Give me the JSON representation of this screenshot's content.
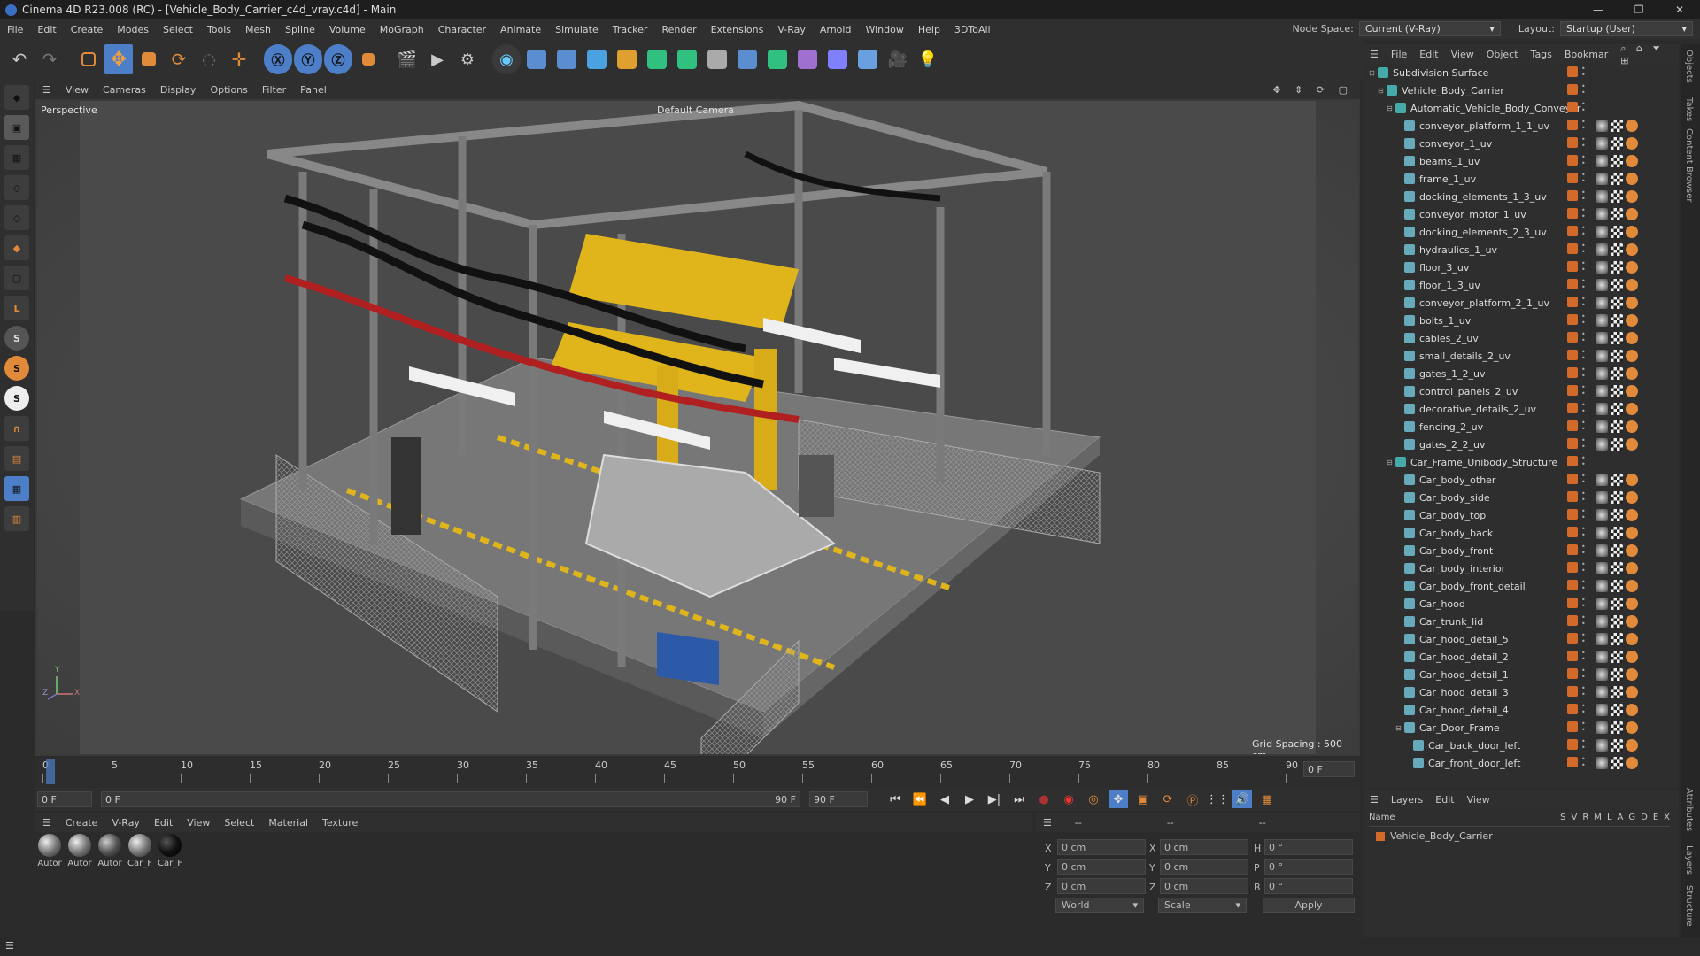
{
  "window": {
    "title": "Cinema 4D R23.008 (RC) - [Vehicle_Body_Carrier_c4d_vray.c4d] - Main",
    "controls": [
      "—",
      "❐",
      "✕"
    ]
  },
  "menu": [
    "File",
    "Edit",
    "Create",
    "Modes",
    "Select",
    "Tools",
    "Mesh",
    "Spline",
    "Volume",
    "MoGraph",
    "Character",
    "Animate",
    "Simulate",
    "Tracker",
    "Render",
    "Extensions",
    "V-Ray",
    "Arnold",
    "Window",
    "Help",
    "3DToAll"
  ],
  "node_space": {
    "label": "Node Space:",
    "value": "Current (V-Ray)"
  },
  "layout": {
    "label": "Layout:",
    "value": "Startup (User)"
  },
  "viewport": {
    "menu": [
      "View",
      "Cameras",
      "Display",
      "Options",
      "Filter",
      "Panel"
    ],
    "view_name": "Perspective",
    "camera": "Default Camera",
    "grid_spacing": "Grid Spacing : 500 cm",
    "axis_labels": [
      "Y",
      "X",
      "Z"
    ]
  },
  "timeline": {
    "ticks": [
      "0",
      "5",
      "10",
      "15",
      "20",
      "25",
      "30",
      "35",
      "40",
      "45",
      "50",
      "55",
      "60",
      "65",
      "70",
      "75",
      "80",
      "85",
      "90"
    ],
    "end_field": "0 F"
  },
  "transport": {
    "current_frame": "0 F",
    "start": "0 F",
    "range_end": "90 F",
    "end": "90 F"
  },
  "material_panel": {
    "menu": [
      "Create",
      "V-Ray",
      "Edit",
      "View",
      "Select",
      "Material",
      "Texture"
    ],
    "materials": [
      "Autor",
      "Autor",
      "Autor",
      "Car_F",
      "Car_F"
    ]
  },
  "attributes": {
    "header_values": [
      "--",
      "--",
      "--"
    ],
    "labels": [
      "X",
      "Y",
      "Z",
      "X",
      "Y",
      "Z",
      "H",
      "P",
      "B"
    ],
    "values": [
      "0 cm",
      "0 cm",
      "0 cm",
      "0 cm",
      "0 cm",
      "0 cm",
      "0 °",
      "0 °",
      "0 °"
    ],
    "world": "World",
    "scale": "Scale",
    "apply": "Apply"
  },
  "object_panel": {
    "menu": [
      "File",
      "Edit",
      "View",
      "Object",
      "Tags",
      "Bookmar"
    ],
    "rows": [
      {
        "name": "Subdivision Surface",
        "indent": 0
      },
      {
        "name": "Vehicle_Body_Carrier",
        "indent": 1
      },
      {
        "name": "Automatic_Vehicle_Body_Conveyor",
        "indent": 2
      },
      {
        "name": "conveyor_platform_1_1_uv",
        "indent": 3
      },
      {
        "name": "conveyor_1_uv",
        "indent": 3
      },
      {
        "name": "beams_1_uv",
        "indent": 3
      },
      {
        "name": "frame_1_uv",
        "indent": 3
      },
      {
        "name": "docking_elements_1_3_uv",
        "indent": 3
      },
      {
        "name": "conveyor_motor_1_uv",
        "indent": 3
      },
      {
        "name": "docking_elements_2_3_uv",
        "indent": 3
      },
      {
        "name": "hydraulics_1_uv",
        "indent": 3
      },
      {
        "name": "floor_3_uv",
        "indent": 3
      },
      {
        "name": "floor_1_3_uv",
        "indent": 3
      },
      {
        "name": "conveyor_platform_2_1_uv",
        "indent": 3
      },
      {
        "name": "bolts_1_uv",
        "indent": 3
      },
      {
        "name": "cables_2_uv",
        "indent": 3
      },
      {
        "name": "small_details_2_uv",
        "indent": 3
      },
      {
        "name": "gates_1_2_uv",
        "indent": 3
      },
      {
        "name": "control_panels_2_uv",
        "indent": 3
      },
      {
        "name": "decorative_details_2_uv",
        "indent": 3
      },
      {
        "name": "fencing_2_uv",
        "indent": 3
      },
      {
        "name": "gates_2_2_uv",
        "indent": 3
      },
      {
        "name": "Car_Frame_Unibody_Structure",
        "indent": 2
      },
      {
        "name": "Car_body_other",
        "indent": 3
      },
      {
        "name": "Car_body_side",
        "indent": 3
      },
      {
        "name": "Car_body_top",
        "indent": 3
      },
      {
        "name": "Car_body_back",
        "indent": 3
      },
      {
        "name": "Car_body_front",
        "indent": 3
      },
      {
        "name": "Car_body_interior",
        "indent": 3
      },
      {
        "name": "Car_body_front_detail",
        "indent": 3
      },
      {
        "name": "Car_hood",
        "indent": 3
      },
      {
        "name": "Car_trunk_lid",
        "indent": 3
      },
      {
        "name": "Car_hood_detail_5",
        "indent": 3
      },
      {
        "name": "Car_hood_detail_2",
        "indent": 3
      },
      {
        "name": "Car_hood_detail_1",
        "indent": 3
      },
      {
        "name": "Car_hood_detail_3",
        "indent": 3
      },
      {
        "name": "Car_hood_detail_4",
        "indent": 3
      },
      {
        "name": "Car_Door_Frame",
        "indent": 3
      },
      {
        "name": "Car_back_door_left",
        "indent": 4
      },
      {
        "name": "Car_front_door_left",
        "indent": 4
      }
    ]
  },
  "layers_panel": {
    "menu": [
      "Layers",
      "Edit",
      "View"
    ],
    "header": "Name",
    "flags": [
      "S",
      "V",
      "R",
      "M",
      "L",
      "A",
      "G",
      "D",
      "E",
      "X"
    ],
    "layer": "Vehicle_Body_Carrier"
  },
  "right_tabs": [
    "Objects",
    "Takes",
    "Content Browser",
    "Attributes",
    "Layers",
    "Structure"
  ],
  "colors": {
    "accent": "#d46a2a",
    "selection": "#4d7fc9",
    "yellow": "#e0b51c"
  }
}
